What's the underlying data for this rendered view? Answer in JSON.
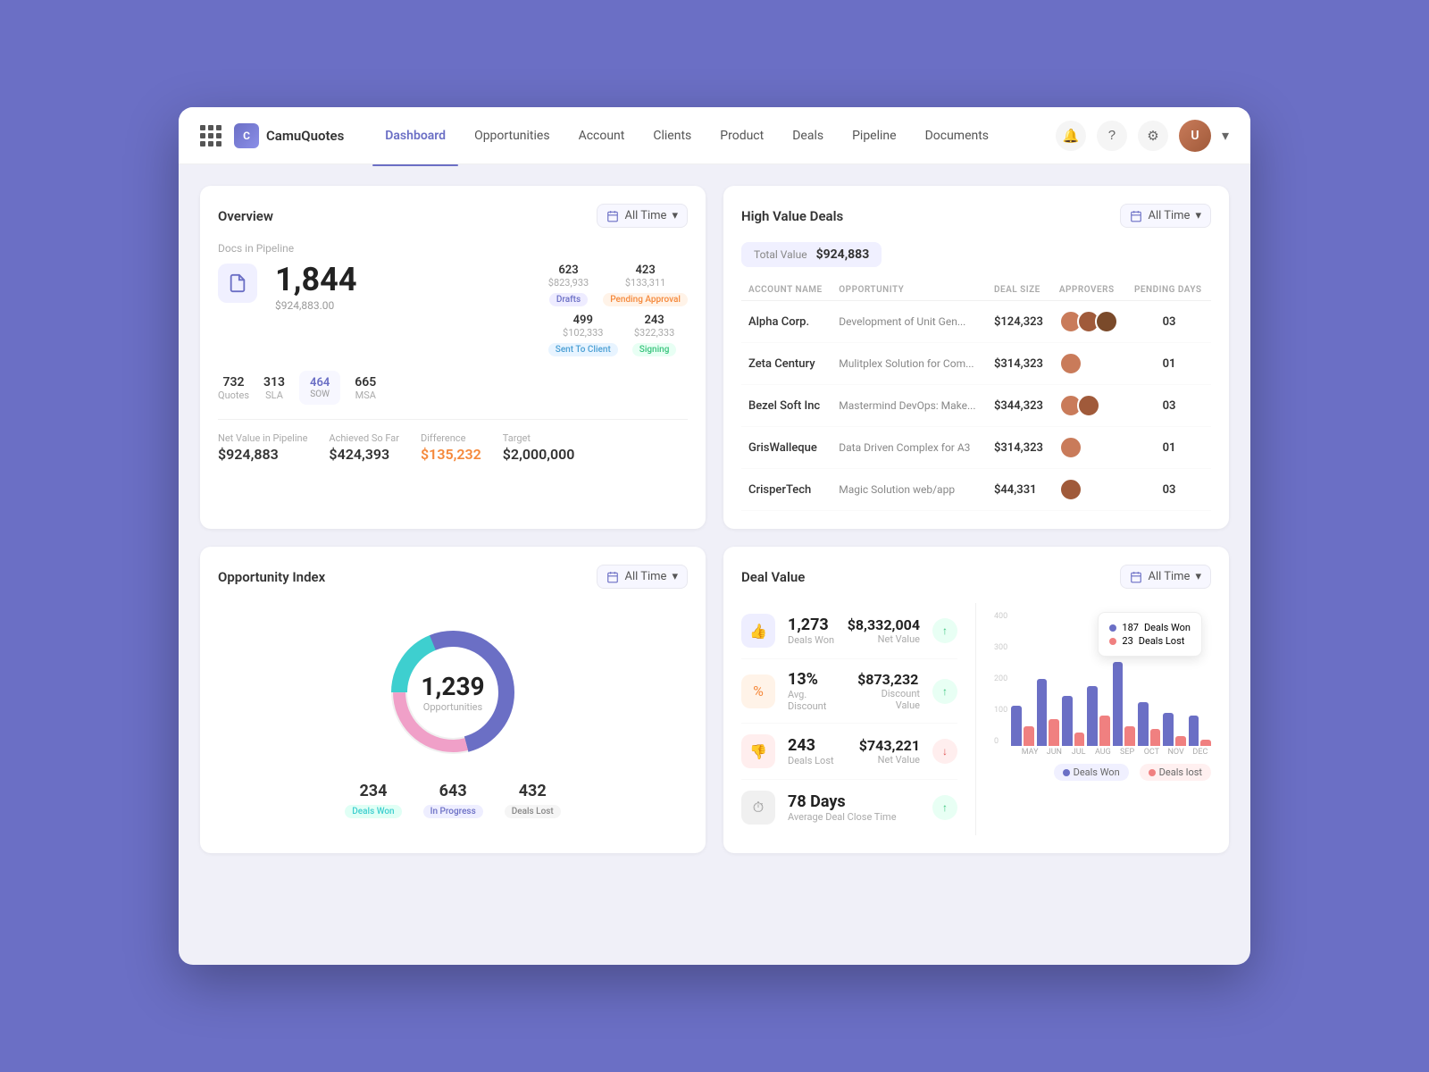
{
  "app": {
    "name": "CamuQuotes"
  },
  "nav": {
    "links": [
      {
        "label": "Dashboard",
        "active": true
      },
      {
        "label": "Opportunities",
        "active": false
      },
      {
        "label": "Account",
        "active": false
      },
      {
        "label": "Clients",
        "active": false
      },
      {
        "label": "Product",
        "active": false
      },
      {
        "label": "Deals",
        "active": false
      },
      {
        "label": "Pipeline",
        "active": false
      },
      {
        "label": "Documents",
        "active": false
      }
    ]
  },
  "overview": {
    "title": "Overview",
    "time_filter": "All Time",
    "docs_in_pipeline": "Docs in Pipeline",
    "big_number": "1,844",
    "big_number_sub": "$924,883.00",
    "drafts_value": "623",
    "drafts_sub": "$823,933",
    "drafts_badge": "Drafts",
    "pending_value": "423",
    "pending_sub": "$133,311",
    "pending_badge": "Pending Approval",
    "sent_value": "499",
    "sent_sub": "$102,333",
    "sent_badge": "Sent To Client",
    "signing_value": "243",
    "signing_sub": "$322,333",
    "signing_badge": "Signing",
    "quotes": "732",
    "quotes_label": "Quotes",
    "sla": "313",
    "sla_label": "SLA",
    "sow": "464",
    "sow_label": "SOW",
    "msa": "665",
    "msa_label": "MSA",
    "net_value_label": "Net Value in Pipeline",
    "net_value": "$924,883",
    "achieved_label": "Achieved So Far",
    "achieved": "$424,393",
    "difference_label": "Difference",
    "difference": "$135,232",
    "target_label": "Target",
    "target": "$2,000,000"
  },
  "high_value_deals": {
    "title": "High Value Deals",
    "time_filter": "All Time",
    "total_label": "Total Value",
    "total_value": "$924,883",
    "columns": [
      "Account Name",
      "Opportunity",
      "Deal Size",
      "Approvers",
      "Pending Days"
    ],
    "rows": [
      {
        "account": "Alpha Corp.",
        "opportunity": "Development of Unit Gen...",
        "deal_size": "$124,323",
        "approvers": [
          "#c97b5a",
          "#a05a3a",
          "#7a4a2a"
        ],
        "pending": "03"
      },
      {
        "account": "Zeta Century",
        "opportunity": "Mulitplex Solution for Com...",
        "deal_size": "$314,323",
        "approvers": [
          "#c97b5a"
        ],
        "pending": "01"
      },
      {
        "account": "Bezel Soft Inc",
        "opportunity": "Mastermind DevOps: Make...",
        "deal_size": "$344,323",
        "approvers": [
          "#c97b5a",
          "#a05a3a"
        ],
        "pending": "03"
      },
      {
        "account": "GrisWalleque",
        "opportunity": "Data Driven Complex for A3",
        "deal_size": "$314,323",
        "approvers": [
          "#c97b5a"
        ],
        "pending": "01"
      },
      {
        "account": "CrisperTech",
        "opportunity": "Magic Solution web/app",
        "deal_size": "$44,331",
        "approvers": [
          "#a05a3a"
        ],
        "pending": "03"
      }
    ]
  },
  "opportunity_index": {
    "title": "Opportunity Index",
    "time_filter": "All Time",
    "total": "1,239",
    "total_label": "Opportunities",
    "deals_won": "234",
    "deals_won_label": "Deals Won",
    "in_progress": "643",
    "in_progress_label": "In Progress",
    "deals_lost": "432",
    "deals_lost_label": "Deals Lost",
    "donut": {
      "won_pct": 19,
      "progress_pct": 52,
      "lost_pct": 29
    }
  },
  "deal_value": {
    "title": "Deal Value",
    "time_filter": "All Time",
    "deals_won_val": "1,273",
    "deals_won_label": "Deals Won",
    "net_value_val": "$8,332,004",
    "net_value_label": "Net Value",
    "avg_discount_val": "13%",
    "avg_discount_label": "Avg. Discount",
    "discount_value_val": "$873,232",
    "discount_value_label": "Discount Value",
    "deals_lost_val": "243",
    "deals_lost_label": "Deals Lost",
    "lost_net_val": "$743,221",
    "lost_net_label": "Net Value",
    "avg_close_val": "78 Days",
    "avg_close_label": "Average Deal Close Time",
    "chart": {
      "months": [
        "MAY",
        "JUN",
        "JUL",
        "AUG",
        "SEP",
        "OCT",
        "NOV",
        "DEC"
      ],
      "won": [
        120,
        200,
        150,
        180,
        250,
        130,
        100,
        90
      ],
      "lost": [
        60,
        80,
        40,
        90,
        60,
        50,
        30,
        20
      ]
    },
    "legend_won": "Deals Won",
    "legend_lost": "Deals lost",
    "tooltip_won_count": "187",
    "tooltip_won_label": "Deals Won",
    "tooltip_lost_count": "23",
    "tooltip_lost_label": "Deals Lost"
  }
}
